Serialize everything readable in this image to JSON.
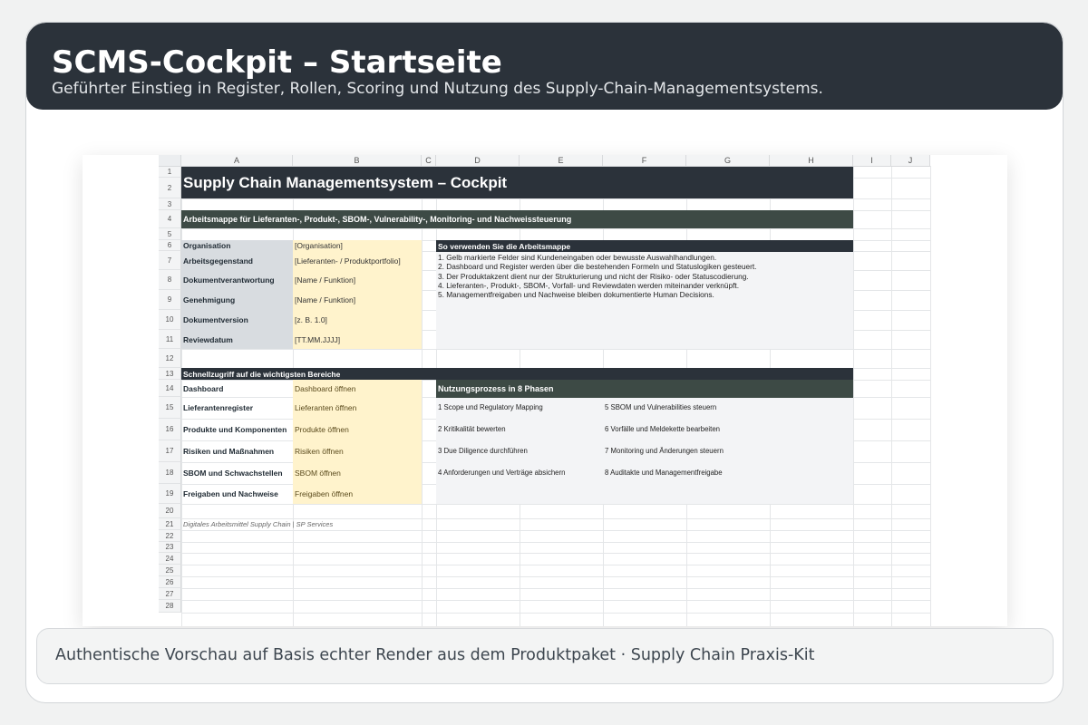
{
  "header": {
    "title": "SCMS-Cockpit – Startseite",
    "subtitle": "Geführter Einstieg in Register, Rollen, Scoring und Nutzung des Supply-Chain-Managementsystems."
  },
  "sheet": {
    "columns": [
      "A",
      "B",
      "C",
      "D",
      "E",
      "F",
      "G",
      "H",
      "I",
      "J"
    ],
    "rows": [
      "1",
      "2",
      "3",
      "4",
      "5",
      "6",
      "7",
      "8",
      "9",
      "10",
      "11",
      "12",
      "13",
      "14",
      "15",
      "16",
      "17",
      "18",
      "19",
      "20",
      "21",
      "22",
      "23",
      "24",
      "25",
      "26",
      "27",
      "28"
    ],
    "title": "Supply Chain Managementsystem – Cockpit",
    "subtitle": "Arbeitsmappe für Lieferanten-, Produkt-, SBOM-, Vulnerability-, Monitoring- und Nachweissteuerung",
    "meta_fields": [
      {
        "label": "Organisation",
        "value": "[Organisation]"
      },
      {
        "label": "Arbeitsgegenstand",
        "value": "[Lieferanten- / Produktportfolio]"
      },
      {
        "label": "Dokumentverantwortung",
        "value": "[Name / Funktion]"
      },
      {
        "label": "Genehmigung",
        "value": "[Name / Funktion]"
      },
      {
        "label": "Dokumentversion",
        "value": "[z. B. 1.0]"
      },
      {
        "label": "Reviewdatum",
        "value": "[TT.MM.JJJJ]"
      }
    ],
    "usage": {
      "title": "So verwenden Sie die Arbeitsmappe",
      "lines": [
        "1. Gelb markierte Felder sind Kundeneingaben oder bewusste Auswahlhandlungen.",
        "2. Dashboard und Register werden über die bestehenden Formeln und Statuslogiken gesteuert.",
        "3. Der Produktakzent dient nur der Strukturierung und nicht der Risiko- oder Statuscodierung.",
        "4. Lieferanten-, Produkt-, SBOM-, Vorfall- und Reviewdaten werden miteinander verknüpft.",
        "5. Managementfreigaben und Nachweise bleiben dokumentierte Human Decisions."
      ]
    },
    "quick_access": {
      "title": "Schnellzugriff auf die wichtigsten Bereiche",
      "items": [
        {
          "label": "Dashboard",
          "link": "Dashboard öffnen"
        },
        {
          "label": "Lieferantenregister",
          "link": "Lieferanten öffnen"
        },
        {
          "label": "Produkte und Komponenten",
          "link": "Produkte öffnen"
        },
        {
          "label": "Risiken und Maßnahmen",
          "link": "Risiken öffnen"
        },
        {
          "label": "SBOM und Schwachstellen",
          "link": "SBOM öffnen"
        },
        {
          "label": "Freigaben und Nachweise",
          "link": "Freigaben öffnen"
        }
      ]
    },
    "process": {
      "title": "Nutzungsprozess in 8 Phasen",
      "phases_left": [
        "1 Scope und Regulatory Mapping",
        "2 Kritikalität bewerten",
        "3 Due Diligence durchführen",
        "4 Anforderungen und Verträge absichern"
      ],
      "phases_right": [
        "5 SBOM und Vulnerabilities steuern",
        "6 Vorfälle und Meldekette bearbeiten",
        "7 Monitoring und Änderungen steuern",
        "8 Auditakte und Managementfreigabe"
      ]
    },
    "footer_note": "Digitales Arbeitsmittel Supply Chain | SP Services"
  },
  "caption": "Authentische Vorschau auf Basis echter Render aus dem Produktpaket · Supply Chain Praxis-Kit",
  "colors": {
    "header_bg": "#2b323a",
    "band_green": "#3d4a45",
    "label_grey": "#d8dce0",
    "input_yellow": "#fff3cc"
  }
}
